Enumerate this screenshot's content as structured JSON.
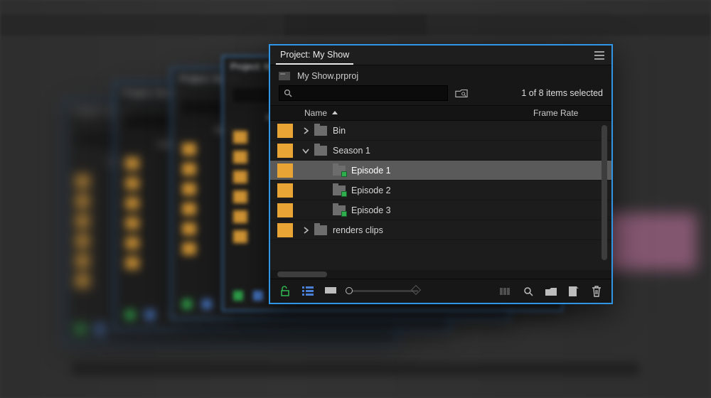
{
  "panel": {
    "tab_title": "Project: My Show",
    "project_file": "My Show.prproj",
    "search_placeholder": "",
    "selection_status": "1 of 8 items selected",
    "columns": {
      "name": "Name",
      "frame_rate": "Frame Rate"
    },
    "ghost_tab": "Project: My Sh",
    "ghost_col": "Name"
  },
  "items": [
    {
      "label": "Bin",
      "type": "folder",
      "depth": 0,
      "disclose": "closed",
      "selected": false
    },
    {
      "label": "Season 1",
      "type": "folder",
      "depth": 0,
      "disclose": "open",
      "selected": false
    },
    {
      "label": "Episode 1",
      "type": "sequence",
      "depth": 1,
      "disclose": "none",
      "selected": true
    },
    {
      "label": "Episode 2",
      "type": "sequence",
      "depth": 1,
      "disclose": "none",
      "selected": false
    },
    {
      "label": "Episode 3",
      "type": "sequence",
      "depth": 1,
      "disclose": "none",
      "selected": false
    },
    {
      "label": "renders clips",
      "type": "folder",
      "depth": 0,
      "disclose": "closed",
      "selected": false
    }
  ]
}
